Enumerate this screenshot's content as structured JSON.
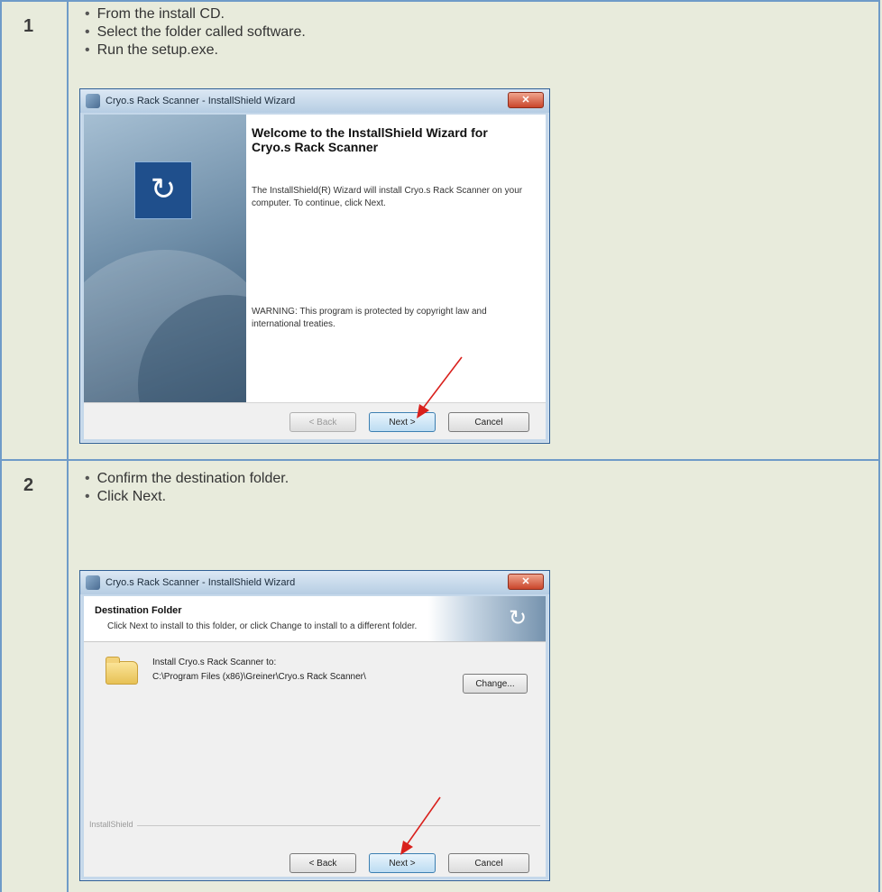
{
  "steps": [
    {
      "number": "1",
      "bullets": [
        "From the install CD.",
        "Select the folder called software.",
        "Run the setup.exe."
      ],
      "dialog": {
        "title": "Cryo.s Rack Scanner - InstallShield Wizard",
        "close_label": "✕",
        "heading": "Welcome to the InstallShield Wizard for Cryo.s Rack Scanner",
        "intro": "The InstallShield(R) Wizard will install Cryo.s Rack Scanner on your computer. To continue, click Next.",
        "warning": "WARNING: This program is protected by copyright law and international treaties.",
        "back_label": "< Back",
        "next_label": "Next >",
        "cancel_label": "Cancel",
        "back_enabled": false
      }
    },
    {
      "number": "2",
      "bullets": [
        "Confirm the destination folder.",
        "Click Next."
      ],
      "dialog": {
        "title": "Cryo.s Rack Scanner - InstallShield Wizard",
        "close_label": "✕",
        "banner_title": "Destination Folder",
        "banner_subtitle": "Click Next to install to this folder, or click Change to install to a different folder.",
        "install_label": "Install Cryo.s Rack Scanner to:",
        "install_path": "C:\\Program Files (x86)\\Greiner\\Cryo.s Rack Scanner\\",
        "change_label": "Change...",
        "footer_brand": "InstallShield",
        "back_label": "< Back",
        "next_label": "Next >",
        "cancel_label": "Cancel"
      }
    }
  ],
  "colors": {
    "page_background": "#e8ebdc",
    "border_blue": "#6f9bc8",
    "arrow_red": "#d9201c"
  },
  "icons": [
    "installer-app-icon",
    "close-icon",
    "cryo-logo-icon",
    "folder-icon",
    "red-arrow-annotation"
  ]
}
